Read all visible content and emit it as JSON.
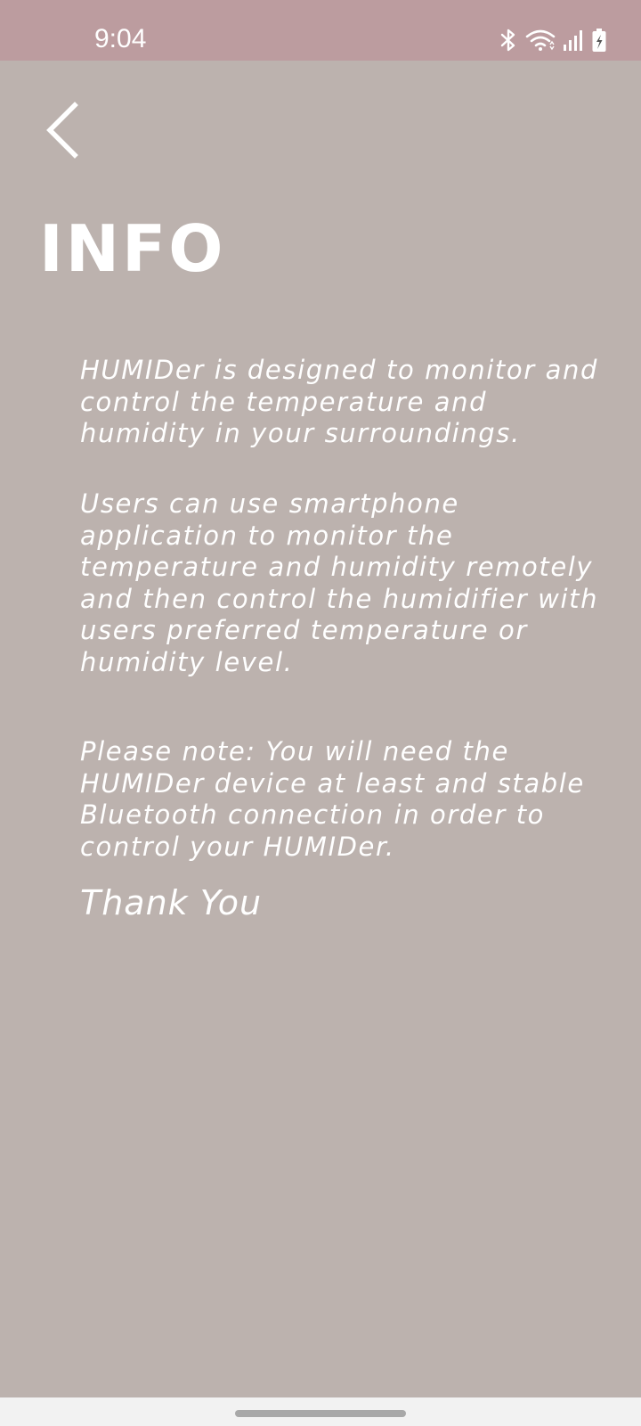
{
  "status_bar": {
    "time": "9:04",
    "icons": [
      "bluetooth-icon",
      "wifi-icon",
      "signal-icon",
      "battery-charging-icon"
    ],
    "background": "#bc9c9f"
  },
  "header": {
    "back_icon": "chevron-left-icon",
    "title": "INFO"
  },
  "content": {
    "paragraph_1": "HUMIDer is designed to monitor and control the temperature and humidity in your surroundings.",
    "paragraph_2": "Users can use smartphone application to monitor the temperature and humidity remotely and then control the humidifier with users preferred temperature or humidity level.",
    "paragraph_3": "Please note: You will need the HUMIDer device at least and stable Bluetooth connection in order to control your HUMIDer.",
    "closing": "Thank You"
  },
  "colors": {
    "background": "#bcb2ae",
    "text": "#ffffff",
    "nav_bar": "#f2f2f2"
  }
}
